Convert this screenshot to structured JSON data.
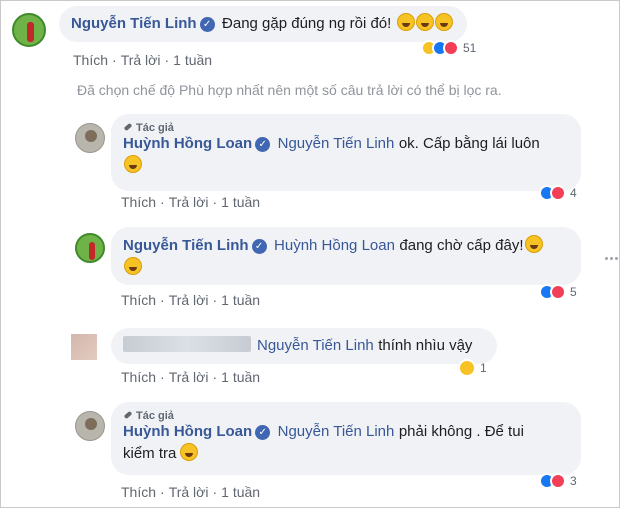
{
  "comments": [
    {
      "author": "Nguyễn Tiến Linh",
      "text": "Đang gặp đúng ng rồi đó!",
      "emoji_count": 3,
      "actions": {
        "like": "Thích",
        "reply": "Trả lời",
        "time": "1 tuần"
      },
      "reaction_count": "51",
      "reactions": [
        "haha-icon",
        "like-icon",
        "love-icon"
      ]
    },
    {
      "author_badge": "Tác giả",
      "author": "Huỳnh Hồng Loan",
      "mention": "Nguyễn Tiến Linh",
      "text": "ok. Cấp bằng lái luôn",
      "actions": {
        "like": "Thích",
        "reply": "Trả lời",
        "time": "1 tuần"
      },
      "reaction_count": "4",
      "reactions": [
        "like-icon",
        "love-icon"
      ]
    },
    {
      "author": "Nguyễn Tiến Linh",
      "mention": "Huỳnh Hồng Loan",
      "text": "đang chờ cấp đây!",
      "actions": {
        "like": "Thích",
        "reply": "Trả lời",
        "time": "1 tuần"
      },
      "reaction_count": "5",
      "reactions": [
        "like-icon",
        "love-icon"
      ]
    },
    {
      "mention": "Nguyễn Tiến Linh",
      "text": "thính nhìu vậy",
      "actions": {
        "like": "Thích",
        "reply": "Trả lời",
        "time": "1 tuần"
      },
      "reaction_count": "1",
      "reactions": [
        "haha-icon"
      ]
    },
    {
      "author_badge": "Tác giả",
      "author": "Huỳnh Hồng Loan",
      "mention": "Nguyễn Tiến Linh",
      "text": "phải không . Để tui",
      "text_line2": "kiểm tra",
      "actions": {
        "like": "Thích",
        "reply": "Trả lời",
        "time": "1 tuần"
      },
      "reaction_count": "3",
      "reactions": [
        "like-icon",
        "love-icon"
      ]
    }
  ],
  "filter_notice": "Đã chọn chế độ Phù hợp nhất nên một số câu trả lời có thể bị lọc ra.",
  "colors": {
    "name_link": "#385898",
    "bubble": "#f0f2f5",
    "meta": "#606770",
    "like": "#1877f2",
    "love": "#f33e58",
    "haha": "#f7c324"
  }
}
